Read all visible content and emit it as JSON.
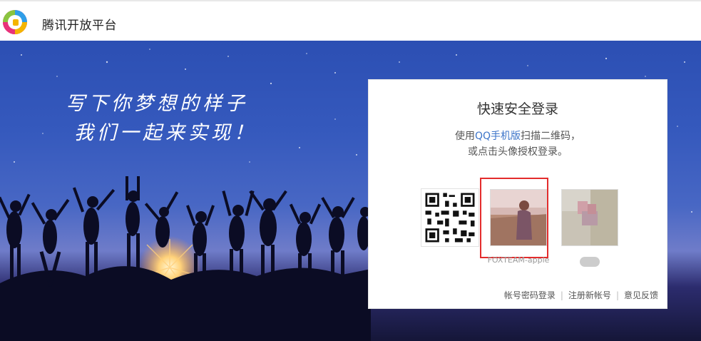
{
  "header": {
    "title": "腾讯开放平台"
  },
  "hero": {
    "slogan_line1": "写下你梦想的样子",
    "slogan_line2": "我们一起来实现！"
  },
  "login": {
    "title": "快速安全登录",
    "desc_prefix": "使用",
    "desc_link": "QQ手机版",
    "desc_suffix": "扫描二维码，",
    "desc_line2": "或点击头像授权登录。",
    "accounts": [
      {
        "name": "FOXTEAM-apple"
      }
    ]
  },
  "footer": {
    "links": [
      "帐号密码登录",
      "注册新帐号",
      "意见反馈"
    ]
  },
  "colors": {
    "accent_link": "#3c74c9",
    "selection": "#e32c2c",
    "hero_top": "#2c4fb3"
  }
}
